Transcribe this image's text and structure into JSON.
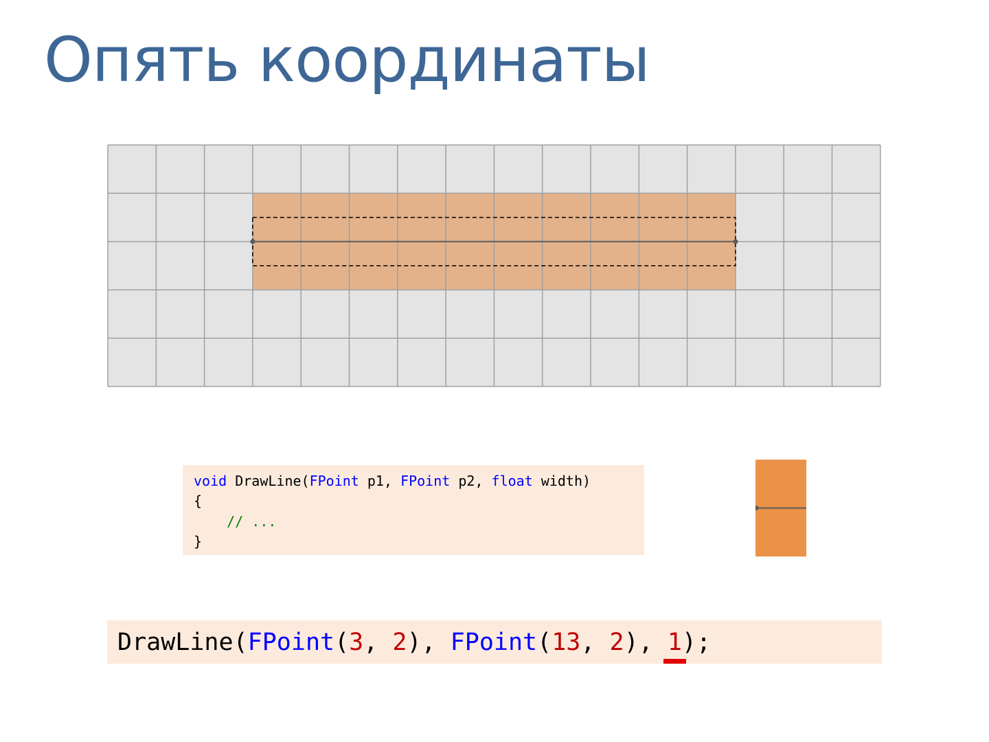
{
  "slide": {
    "title": "Опять координаты"
  },
  "colors": {
    "title": "#3E6796",
    "grid_bg": "#E4E4E4",
    "grid_line": "#A0A0A0",
    "covered_fill": "#E4B28A",
    "pixel_fill": "#EA9248",
    "code_bg": "#FCEBDD",
    "keyword": "#0000FF",
    "number": "#C00000",
    "comment": "#008000",
    "underline": "#E00000",
    "line": "#5C5C5C"
  },
  "diagram": {
    "grid_cols": 16,
    "grid_rows": 5,
    "line": {
      "p1": [
        3,
        2
      ],
      "p2": [
        13,
        2
      ],
      "width": 1
    },
    "covered_cells": {
      "col_from": 3,
      "col_to": 13,
      "row_from": 1,
      "row_to": 3
    }
  },
  "code": {
    "kw_void": "void",
    "fn_name": "DrawLine(",
    "type1": "FPoint",
    "p1": "p1,",
    "type2": "FPoint",
    "p2": "p2,",
    "kw_float": "float",
    "width_param": "width)",
    "open_brace": "{",
    "comment": "// ...",
    "close_brace": "}"
  },
  "call": {
    "fn": "DrawLine(",
    "type1": "FPoint",
    "x1": "3",
    "y1": "2",
    "type2": "FPoint",
    "x2": "13",
    "y2": "2",
    "width": "1",
    "end": ");"
  }
}
